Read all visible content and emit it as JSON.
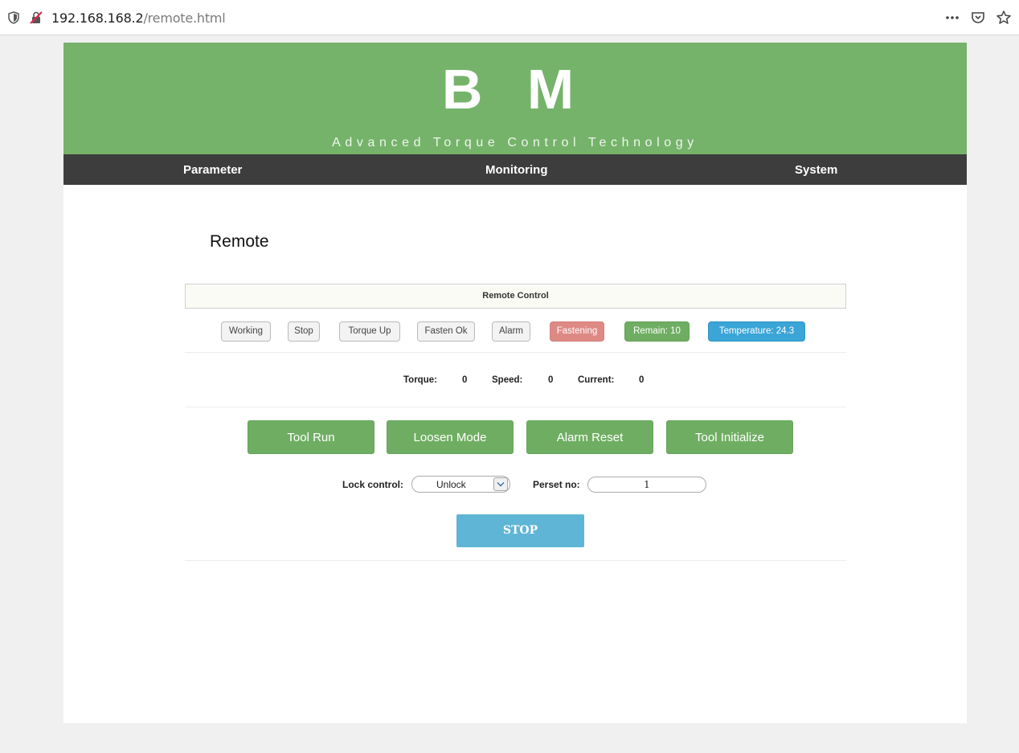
{
  "browser": {
    "url_host": "192.168.168.2",
    "url_path": "/remote.html"
  },
  "header": {
    "logo": "B M",
    "tagline": "Advanced Torque Control Technology"
  },
  "nav": {
    "items": [
      {
        "label": "Parameter"
      },
      {
        "label": "Monitoring"
      },
      {
        "label": "System"
      }
    ]
  },
  "page": {
    "title": "Remote"
  },
  "panel": {
    "heading": "Remote Control"
  },
  "status_chips": [
    {
      "label": "Working",
      "state": "inactive"
    },
    {
      "label": "Stop",
      "state": "inactive"
    },
    {
      "label": "Torque Up",
      "state": "inactive"
    },
    {
      "label": "Fasten Ok",
      "state": "inactive"
    },
    {
      "label": "Alarm",
      "state": "inactive"
    },
    {
      "label": "Fastening",
      "state": "active-red"
    },
    {
      "label": "Remain: 10",
      "state": "active-green"
    },
    {
      "label": "Temperature: 24.3",
      "state": "active-blue"
    }
  ],
  "readouts": {
    "torque_label": "Torque:",
    "torque_value": "0",
    "speed_label": "Speed:",
    "speed_value": "0",
    "current_label": "Current:",
    "current_value": "0"
  },
  "actions": {
    "tool_run": "Tool Run",
    "loosen_mode": "Loosen Mode",
    "alarm_reset": "Alarm Reset",
    "tool_initialize": "Tool Initialize"
  },
  "controls": {
    "lock_label": "Lock control:",
    "lock_value": "Unlock",
    "preset_label": "Perset no:",
    "preset_value": "1"
  },
  "stop_button": "STOP",
  "colors": {
    "header_green": "#75b36a",
    "nav_dark": "#3d3d3d",
    "button_green": "#6fae62",
    "chip_red": "#de8a84",
    "chip_blue": "#3aa5d6",
    "stop_blue": "#5fb5d6"
  }
}
